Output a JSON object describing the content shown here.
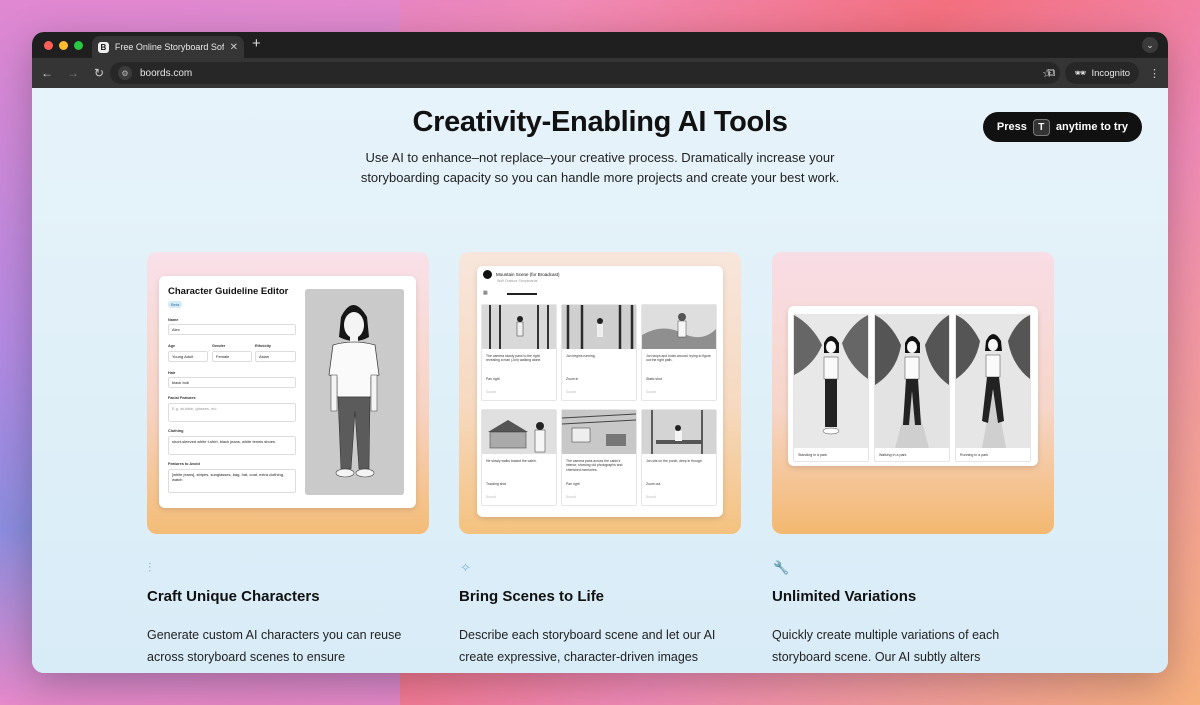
{
  "browser": {
    "tab_title": "Free Online Storyboard Softw",
    "favicon_letter": "B",
    "url": "boords.com",
    "incognito_label": "Incognito"
  },
  "hero": {
    "title": "Creativity-Enabling AI Tools",
    "subtitle_line1": "Use AI to enhance–not replace–your creative process. Dramatically increase your",
    "subtitle_line2": "storyboarding capacity so you can handle more projects and create your best work.",
    "press_prefix": "Press",
    "press_key": "T",
    "press_suffix": "anytime to try"
  },
  "card1": {
    "title": "Character Guideline Editor",
    "badge": "Beta",
    "fields": {
      "name_label": "Name",
      "name_value": "Alex",
      "age_label": "Age",
      "age_value": "Young Adult",
      "gender_label": "Gender",
      "gender_value": "Female",
      "ethnicity_label": "Ethnicity",
      "ethnicity_value": "Asian",
      "hair_label": "Hair",
      "hair_value": "black bob",
      "facial_label": "Facial Features",
      "facial_placeholder": "E.g. stubble, glasses, etc",
      "clothing_label": "Clothing",
      "clothing_value": "short-sleeved white t-shirt, black jeans, white tennis shoes",
      "avoid_label": "Features to Avoid",
      "avoid_value": "[white jeans], stripes, sunglasses, bag, hat, coat, extra clothing, watch"
    }
  },
  "card2": {
    "project": "Mountain Scene (for Broadcast)",
    "workspace": "Wolf Outdoor Storyboards",
    "frames": [
      {
        "desc": "The camera slowly pans to the right, revealing a man (Jon) walking alone.",
        "shot": "Pan right",
        "sfx": "Sound"
      },
      {
        "desc": "Jon begins running.",
        "shot": "Zoom in",
        "sfx": "Sound"
      },
      {
        "desc": "Jon stops and looks around, trying to figure out the right path.",
        "shot": "Static shot",
        "sfx": "Sound"
      },
      {
        "desc": "He slowly walks toward the cabin.",
        "shot": "Tracking shot",
        "sfx": "Sound"
      },
      {
        "desc": "The camera pans across the cabin's interior, showing old photographs and cherished memories.",
        "shot": "Pan right",
        "sfx": "Sound"
      },
      {
        "desc": "Jon sits on the porch, deep in though.",
        "shot": "Zoom out",
        "sfx": "Sound"
      }
    ]
  },
  "card3": {
    "frames": [
      {
        "caption": "Standing in a park"
      },
      {
        "caption": "Walking in a park"
      },
      {
        "caption": "Running in a park"
      }
    ]
  },
  "features": [
    {
      "icon": "sliders-icon",
      "title": "Craft Unique Characters",
      "line1": "Generate custom AI characters you can reuse",
      "line2": "across storyboard scenes to ensure"
    },
    {
      "icon": "sparkles-icon",
      "title": "Bring Scenes to Life",
      "line1": "Describe each storyboard scene and let our AI",
      "line2": "create expressive, character-driven images"
    },
    {
      "icon": "wrench-icon",
      "title": "Unlimited Variations",
      "line1": "Quickly create multiple variations of each",
      "line2": "storyboard scene. Our AI subtly alters"
    }
  ]
}
